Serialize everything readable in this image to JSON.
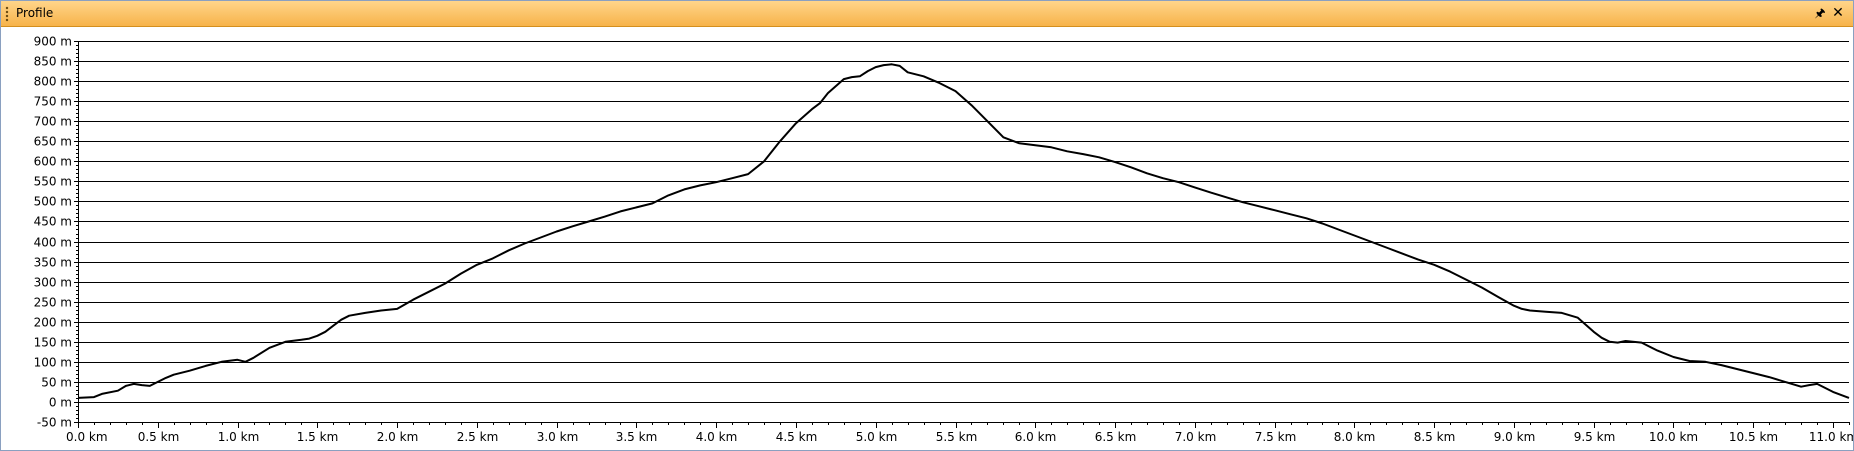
{
  "window": {
    "title": "Profile",
    "pin_icon": "pin-icon",
    "close_icon": "close-icon"
  },
  "colors": {
    "titlebar": "#f7b34a",
    "line": "#000000",
    "grid": "#000000",
    "background": "#ffffff"
  },
  "chart_data": {
    "type": "line",
    "title": "",
    "xlabel": "",
    "ylabel": "",
    "xlim": [
      0,
      11.1
    ],
    "ylim": [
      -50,
      900
    ],
    "grid": true,
    "legend": "none",
    "x_ticks": [
      {
        "value": 0.0,
        "label": "0.0 km"
      },
      {
        "value": 0.5,
        "label": "0.5 km"
      },
      {
        "value": 1.0,
        "label": "1.0 km"
      },
      {
        "value": 1.5,
        "label": "1.5 km"
      },
      {
        "value": 2.0,
        "label": "2.0 km"
      },
      {
        "value": 2.5,
        "label": "2.5 km"
      },
      {
        "value": 3.0,
        "label": "3.0 km"
      },
      {
        "value": 3.5,
        "label": "3.5 km"
      },
      {
        "value": 4.0,
        "label": "4.0 km"
      },
      {
        "value": 4.5,
        "label": "4.5 km"
      },
      {
        "value": 5.0,
        "label": "5.0 km"
      },
      {
        "value": 5.5,
        "label": "5.5 km"
      },
      {
        "value": 6.0,
        "label": "6.0 km"
      },
      {
        "value": 6.5,
        "label": "6.5 km"
      },
      {
        "value": 7.0,
        "label": "7.0 km"
      },
      {
        "value": 7.5,
        "label": "7.5 km"
      },
      {
        "value": 8.0,
        "label": "8.0 km"
      },
      {
        "value": 8.5,
        "label": "8.5 km"
      },
      {
        "value": 9.0,
        "label": "9.0 km"
      },
      {
        "value": 9.5,
        "label": "9.5 km"
      },
      {
        "value": 10.0,
        "label": "10.0 km"
      },
      {
        "value": 10.5,
        "label": "10.5 km"
      },
      {
        "value": 11.0,
        "label": "11.0 km"
      }
    ],
    "y_ticks": [
      {
        "value": 900,
        "label": "900 m"
      },
      {
        "value": 850,
        "label": "850 m"
      },
      {
        "value": 800,
        "label": "800 m"
      },
      {
        "value": 750,
        "label": "750 m"
      },
      {
        "value": 700,
        "label": "700 m"
      },
      {
        "value": 650,
        "label": "650 m"
      },
      {
        "value": 600,
        "label": "600 m"
      },
      {
        "value": 550,
        "label": "550 m"
      },
      {
        "value": 500,
        "label": "500 m"
      },
      {
        "value": 450,
        "label": "450 m"
      },
      {
        "value": 400,
        "label": "400 m"
      },
      {
        "value": 350,
        "label": "350 m"
      },
      {
        "value": 300,
        "label": "300 m"
      },
      {
        "value": 250,
        "label": "250 m"
      },
      {
        "value": 200,
        "label": "200 m"
      },
      {
        "value": 150,
        "label": "150 m"
      },
      {
        "value": 100,
        "label": "100 m"
      },
      {
        "value": 50,
        "label": "50 m"
      },
      {
        "value": 0,
        "label": "0 m"
      },
      {
        "value": -50,
        "label": "-50 m"
      }
    ],
    "series": [
      {
        "x": [
          0.0,
          0.1,
          0.15,
          0.25,
          0.3,
          0.35,
          0.4,
          0.45,
          0.5,
          0.55,
          0.6,
          0.7,
          0.8,
          0.9,
          1.0,
          1.05,
          1.1,
          1.2,
          1.3,
          1.4,
          1.45,
          1.5,
          1.55,
          1.6,
          1.65,
          1.7,
          1.8,
          1.9,
          2.0,
          2.1,
          2.2,
          2.3,
          2.4,
          2.5,
          2.6,
          2.7,
          2.8,
          2.9,
          3.0,
          3.1,
          3.2,
          3.3,
          3.4,
          3.5,
          3.6,
          3.7,
          3.8,
          3.9,
          4.0,
          4.1,
          4.2,
          4.3,
          4.4,
          4.5,
          4.6,
          4.65,
          4.7,
          4.8,
          4.85,
          4.9,
          4.95,
          5.0,
          5.05,
          5.1,
          5.15,
          5.2,
          5.3,
          5.4,
          5.5,
          5.6,
          5.7,
          5.8,
          5.9,
          6.0,
          6.1,
          6.2,
          6.3,
          6.4,
          6.5,
          6.6,
          6.7,
          6.8,
          6.9,
          7.0,
          7.1,
          7.2,
          7.3,
          7.4,
          7.5,
          7.6,
          7.7,
          7.8,
          7.9,
          8.0,
          8.1,
          8.2,
          8.3,
          8.4,
          8.5,
          8.6,
          8.7,
          8.8,
          8.9,
          9.0,
          9.05,
          9.1,
          9.2,
          9.3,
          9.4,
          9.5,
          9.55,
          9.6,
          9.65,
          9.7,
          9.8,
          9.9,
          10.0,
          10.1,
          10.2,
          10.3,
          10.4,
          10.5,
          10.6,
          10.7,
          10.8,
          10.85,
          10.9,
          11.0,
          11.1
        ],
        "y": [
          10,
          12,
          20,
          28,
          40,
          45,
          42,
          40,
          50,
          60,
          68,
          78,
          90,
          100,
          105,
          100,
          110,
          135,
          150,
          155,
          158,
          165,
          175,
          190,
          205,
          215,
          222,
          228,
          232,
          255,
          275,
          295,
          320,
          342,
          358,
          378,
          395,
          410,
          425,
          438,
          450,
          462,
          475,
          485,
          495,
          515,
          530,
          540,
          548,
          558,
          568,
          600,
          650,
          695,
          730,
          745,
          770,
          805,
          810,
          812,
          825,
          835,
          840,
          842,
          838,
          822,
          812,
          795,
          775,
          740,
          700,
          660,
          645,
          640,
          635,
          625,
          618,
          610,
          598,
          585,
          570,
          558,
          548,
          535,
          522,
          510,
          498,
          488,
          478,
          468,
          458,
          445,
          430,
          415,
          400,
          385,
          370,
          355,
          342,
          325,
          305,
          285,
          262,
          240,
          232,
          228,
          225,
          222,
          210,
          175,
          160,
          150,
          148,
          152,
          148,
          128,
          112,
          102,
          100,
          92,
          82,
          72,
          62,
          50,
          38,
          42,
          45,
          25,
          10
        ]
      }
    ]
  }
}
